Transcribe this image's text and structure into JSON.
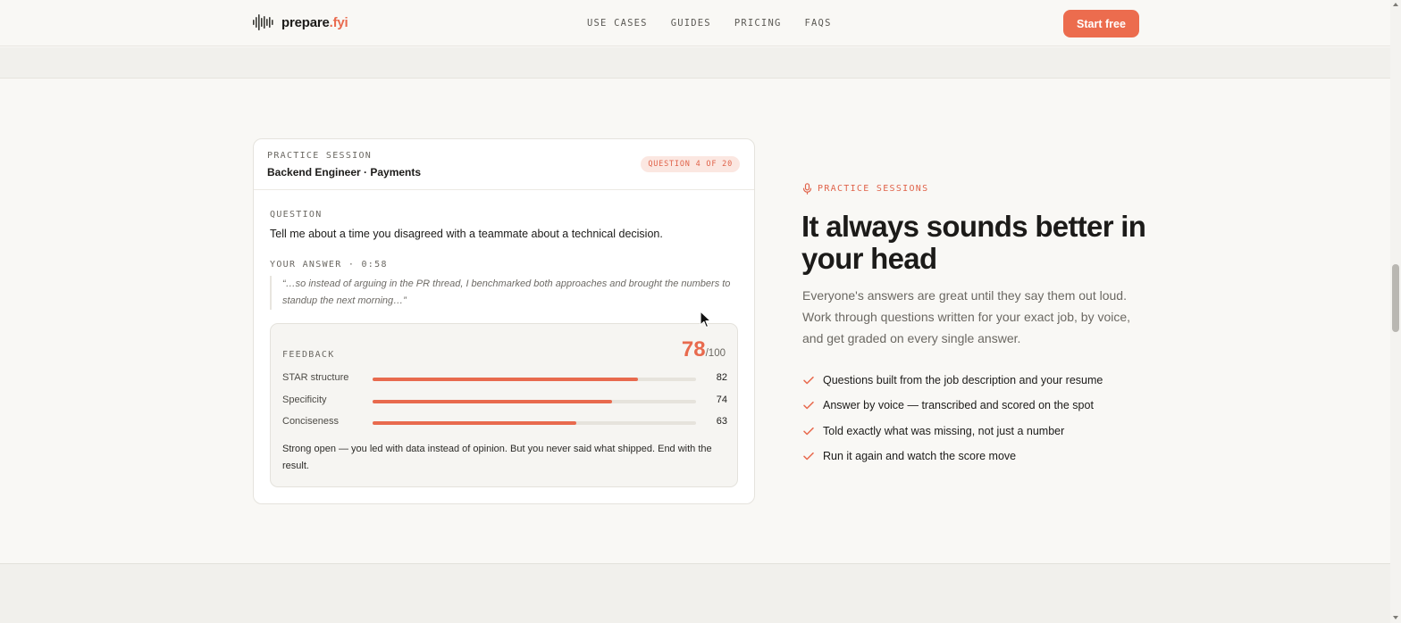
{
  "header": {
    "brand": {
      "name": "prepare",
      "tld": ".fyi",
      "icon": "waveform-icon"
    },
    "nav": [
      "USE CASES",
      "GUIDES",
      "PRICING",
      "FAQS"
    ],
    "cta_label": "Start free"
  },
  "session_card": {
    "eyebrow": "PRACTICE SESSION",
    "title": "Backend Engineer · Payments",
    "badge": "QUESTION 4 OF 20",
    "question_label": "QUESTION",
    "question": "Tell me about a time you disagreed with a teammate about a technical decision.",
    "answer_label": "YOUR ANSWER · 0:58",
    "answer": "“…so instead of arguing in the PR thread, I benchmarked both approaches and brought the numbers to standup the next morning…”",
    "feedback": {
      "label": "FEEDBACK",
      "score": "78",
      "score_total": "/100",
      "metrics": [
        {
          "label": "STAR structure",
          "value": 82
        },
        {
          "label": "Specificity",
          "value": 74
        },
        {
          "label": "Conciseness",
          "value": 63
        }
      ],
      "comment": "Strong open — you led with data instead of opinion. But you never said what shipped. End with the result."
    }
  },
  "section": {
    "kicker": "PRACTICE SESSIONS",
    "kicker_icon": "microphone-icon",
    "headline": "It always sounds better in your head",
    "lead": "Everyone's answers are great until they say them out loud. Work through questions written for your exact job, by voice, and get graded on every single answer.",
    "features": [
      "Questions built from the job description and your resume",
      "Answer by voice — transcribed and scored on the spot",
      "Told exactly what was missing, not just a number",
      "Run it again and watch the score move"
    ],
    "feature_icon": "check-icon"
  },
  "colors": {
    "accent": "#ec6c4e",
    "background": "#f9f8f5",
    "text": "#1c1b19"
  }
}
